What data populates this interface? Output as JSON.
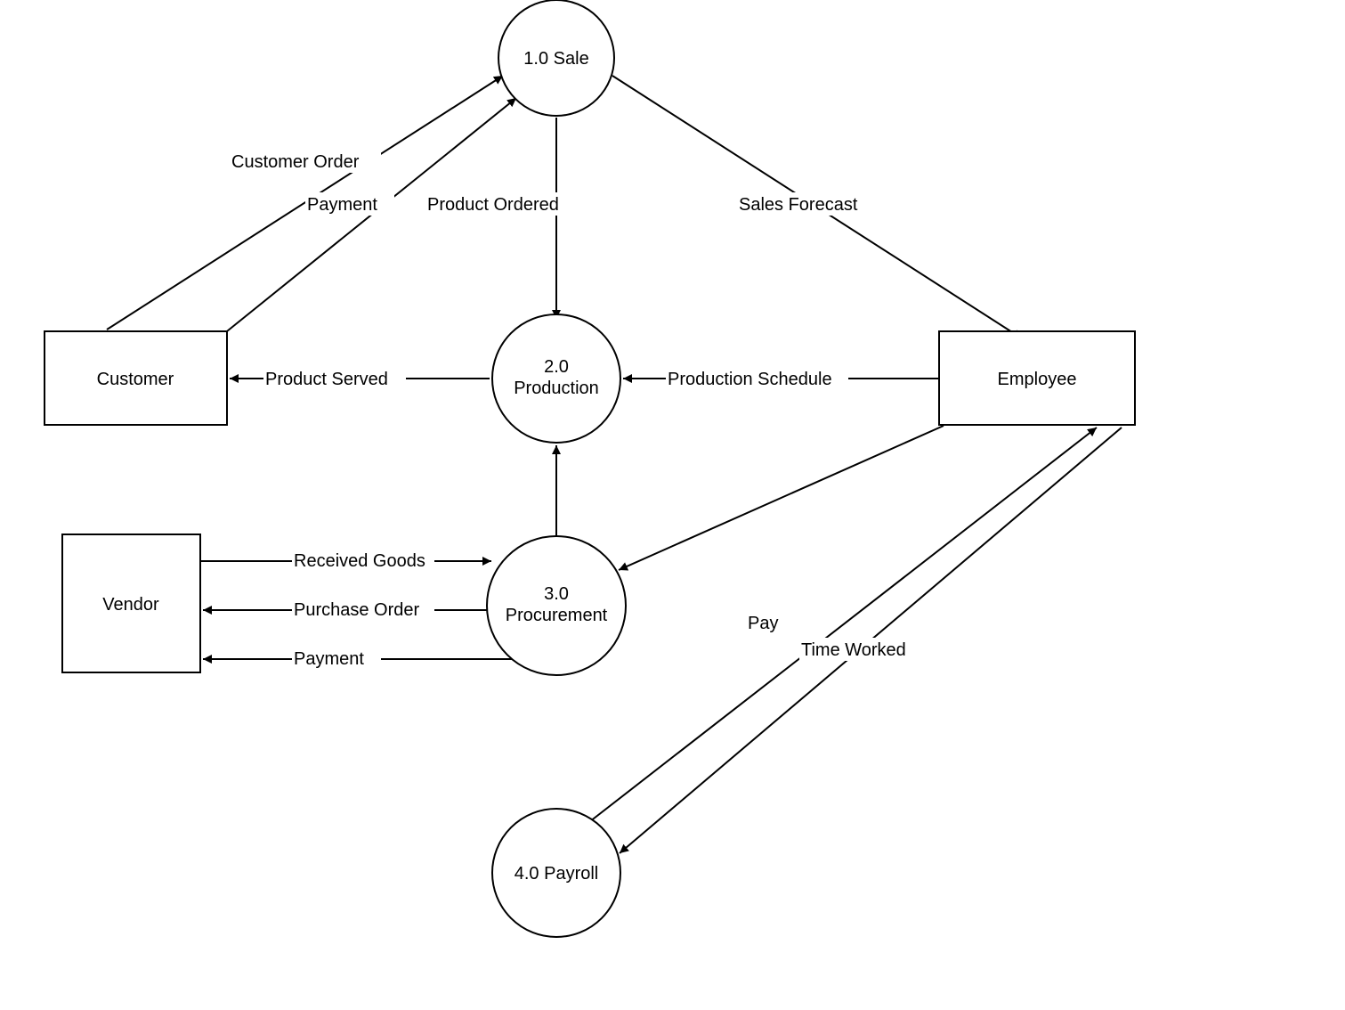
{
  "nodes": {
    "customer": {
      "label": "Customer"
    },
    "vendor": {
      "label": "Vendor"
    },
    "employee": {
      "label": "Employee"
    },
    "sale": {
      "label1": "1.0 Sale"
    },
    "production": {
      "label1": "2.0",
      "label2": "Production"
    },
    "procurement": {
      "label1": "3.0",
      "label2": "Procurement"
    },
    "payroll": {
      "label1": "4.0 Payroll"
    }
  },
  "edges": {
    "customer_order": "Customer Order",
    "payment_customer": "Payment",
    "product_ordered": "Product Ordered",
    "sales_forecast": "Sales Forecast",
    "product_served": "Product Served",
    "production_schedule": "Production Schedule",
    "received_goods": "Received Goods",
    "purchase_order": "Purchase Order",
    "payment_vendor": "Payment",
    "pay": "Pay",
    "time_worked": "Time Worked"
  }
}
